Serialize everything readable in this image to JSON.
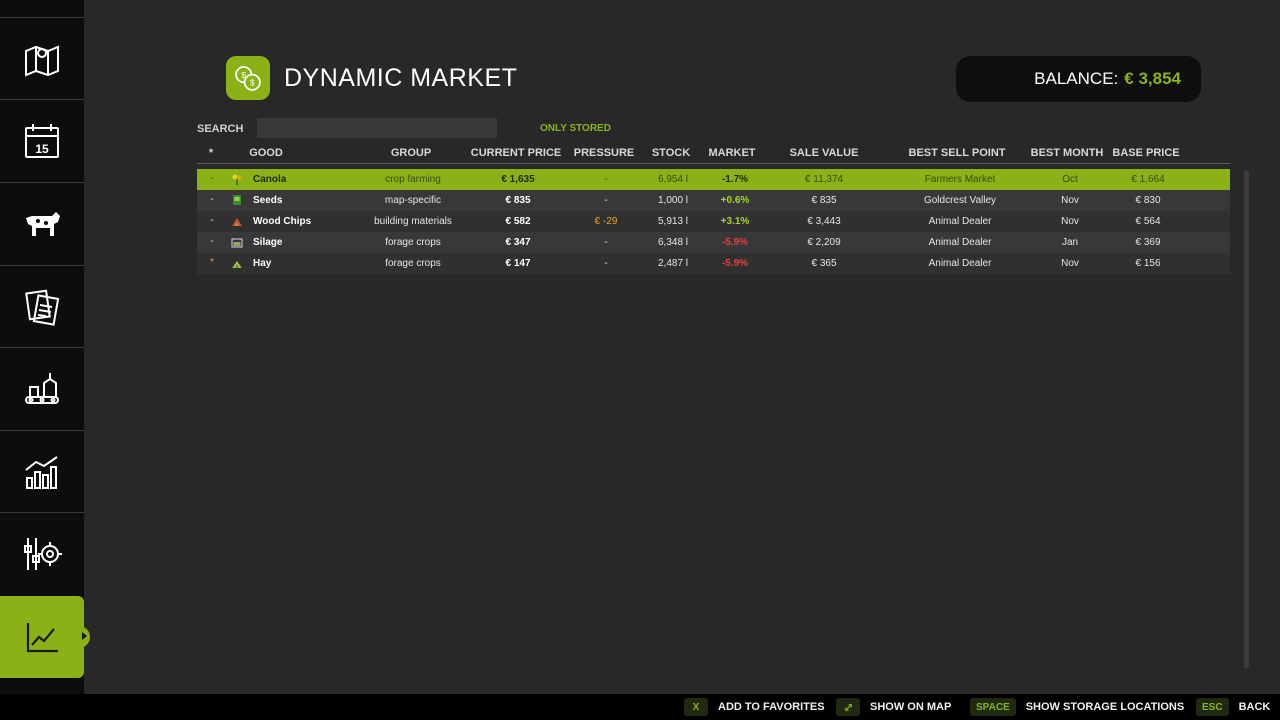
{
  "header": {
    "title": "DYNAMIC MARKET",
    "balance_label": "BALANCE:",
    "balance_value": "€ 3,854"
  },
  "search": {
    "label": "SEARCH",
    "value": "",
    "placeholder": ""
  },
  "filter": {
    "only_stored": "ONLY STORED"
  },
  "sidebar": {
    "items": [
      {
        "icon": "map-icon"
      },
      {
        "icon": "calendar-icon",
        "text": "15"
      },
      {
        "icon": "cow-icon"
      },
      {
        "icon": "contracts-icon"
      },
      {
        "icon": "production-icon"
      },
      {
        "icon": "statistics-icon"
      },
      {
        "icon": "settings-icon"
      },
      {
        "icon": "price-chart-icon",
        "active": true
      }
    ]
  },
  "table": {
    "headers": {
      "fav": "*",
      "good": "GOOD",
      "group": "GROUP",
      "current_price": "CURRENT PRICE",
      "pressure": "PRESSURE",
      "stock": "STOCK",
      "market": "MARKET",
      "sale_value": "SALE VALUE",
      "best_sell_point": "BEST SELL POINT",
      "best_month": "BEST MONTH",
      "base_price": "BASE PRICE"
    },
    "rows": [
      {
        "fav": "-",
        "good": "Canola",
        "icon": "canola-icon",
        "group": "crop farming",
        "price": "€ 1,635",
        "pressure": "-",
        "stock": "6,954 l",
        "market": "-1.7%",
        "market_sign": "neg",
        "sale_value": "€ 11,374",
        "sell_point": "Farmers Market",
        "month": "Oct",
        "base": "€ 1,664",
        "selected": true
      },
      {
        "fav": "-",
        "good": "Seeds",
        "icon": "seeds-icon",
        "group": "map-specific",
        "price": "€ 835",
        "pressure": "-",
        "stock": "1,000 l",
        "market": "+0.6%",
        "market_sign": "pos",
        "sale_value": "€ 835",
        "sell_point": "Goldcrest Valley",
        "month": "Nov",
        "base": "€ 830"
      },
      {
        "fav": "-",
        "good": "Wood Chips",
        "icon": "woodchips-icon",
        "group": "building materials",
        "price": "€ 582",
        "pressure": "€ -29",
        "pressure_color": "orange",
        "stock": "5,913 l",
        "market": "+3.1%",
        "market_sign": "pos",
        "sale_value": "€ 3,443",
        "sell_point": "Animal Dealer",
        "month": "Nov",
        "base": "€ 564"
      },
      {
        "fav": "-",
        "good": "Silage",
        "icon": "silage-icon",
        "group": "forage crops",
        "price": "€ 347",
        "pressure": "-",
        "stock": "6,348 l",
        "market": "-5.9%",
        "market_sign": "neg",
        "sale_value": "€ 2,209",
        "sell_point": "Animal Dealer",
        "month": "Jan",
        "base": "€ 369"
      },
      {
        "fav": "*",
        "fav_star": true,
        "good": "Hay",
        "icon": "hay-icon",
        "group": "forage crops",
        "price": "€ 147",
        "pressure": "-",
        "stock": "2,487 l",
        "market": "-5.9%",
        "market_sign": "neg",
        "sale_value": "€ 365",
        "sell_point": "Animal Dealer",
        "month": "Nov",
        "base": "€ 156"
      }
    ]
  },
  "bottombar": {
    "hints": [
      {
        "key": "X",
        "label": "ADD TO FAVORITES"
      },
      {
        "key": "🖱",
        "label": "SHOW ON MAP"
      },
      {
        "key": "SPACE",
        "label": "SHOW STORAGE LOCATIONS"
      },
      {
        "key": "ESC",
        "label": "BACK"
      }
    ]
  },
  "colors": {
    "accent": "#8ab217",
    "background": "#282828",
    "negative": "#e04040",
    "positive": "#a4d42a",
    "pressure": "#e8a020"
  }
}
